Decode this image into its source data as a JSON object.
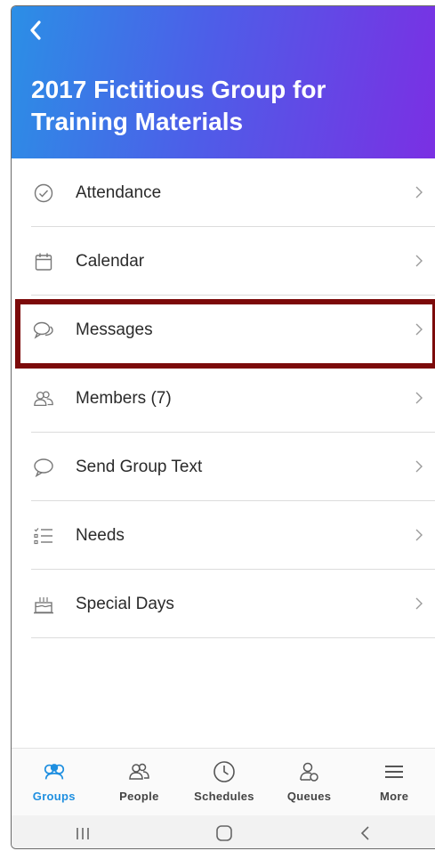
{
  "header": {
    "title": "2017 Fictitious Group for Training Materials",
    "back_icon": "chevron-left-icon"
  },
  "menu": {
    "items": [
      {
        "label": "Attendance",
        "icon": "check-circle-icon"
      },
      {
        "label": "Calendar",
        "icon": "calendar-icon"
      },
      {
        "label": "Messages",
        "icon": "chat-bubbles-icon",
        "highlighted": true
      },
      {
        "label": "Members (7)",
        "icon": "members-icon"
      },
      {
        "label": "Send Group Text",
        "icon": "speech-bubble-icon"
      },
      {
        "label": "Needs",
        "icon": "checklist-icon"
      },
      {
        "label": "Special Days",
        "icon": "cake-icon"
      }
    ]
  },
  "tabbar": {
    "tabs": [
      {
        "label": "Groups",
        "icon": "groups-icon",
        "active": true
      },
      {
        "label": "People",
        "icon": "people-icon"
      },
      {
        "label": "Schedules",
        "icon": "clock-icon"
      },
      {
        "label": "Queues",
        "icon": "queue-person-icon"
      },
      {
        "label": "More",
        "icon": "hamburger-icon"
      }
    ]
  },
  "colors": {
    "header_gradient_start": "#2b8fe6",
    "header_gradient_end": "#7b2fe3",
    "active_tab": "#1f8fe0",
    "highlight_border": "#7c0a0a"
  }
}
